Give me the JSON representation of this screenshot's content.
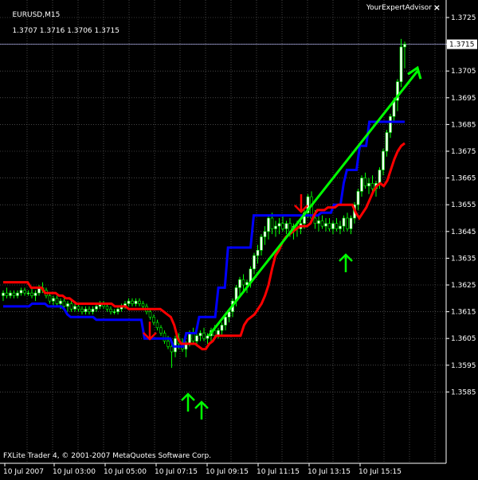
{
  "header": {
    "symbol": "EURUSD,M15",
    "ohlc": "1.3707 1.3716 1.3706 1.3715"
  },
  "expert": {
    "name": "YourExpertAdvisor",
    "close_glyph": "×",
    "icon": "close-icon"
  },
  "footer": {
    "copyright": "FXLite Trader 4, © 2001-2007 MetaQuotes Software Corp."
  },
  "price_label": "1.3715",
  "colors": {
    "background": "#000000",
    "grid": "#707070",
    "up_candle": "#ffffff",
    "down_candle": "#000000",
    "upper_line": "#0000ff",
    "lower_line": "#ff0000",
    "trend_arrow": "#00ff00",
    "signal_down": "#ff0000",
    "signal_up": "#00ff00",
    "current_price_line": "#c0c0ff"
  },
  "chart_data": {
    "type": "line",
    "x_labels": [
      "10 Jul 2007",
      "10 Jul 03:00",
      "10 Jul 05:00",
      "10 Jul 07:15",
      "10 Jul 09:15",
      "10 Jul 11:15",
      "10 Jul 13:15",
      "10 Jul 15:15"
    ],
    "y_ticks": [
      "1.3725",
      "1.3715",
      "1.3705",
      "1.3695",
      "1.3685",
      "1.3675",
      "1.3665",
      "1.3655",
      "1.3645",
      "1.3635",
      "1.3625",
      "1.3615",
      "1.3605",
      "1.3595",
      "1.3585"
    ],
    "ylim": [
      1.3585,
      1.3725
    ],
    "grid": true,
    "current_price": 1.3715,
    "series": [
      {
        "color": "#0000ff",
        "values": [
          1.3617,
          1.3617,
          1.3617,
          1.3617,
          1.3617,
          1.3617,
          1.3617,
          1.3617,
          1.3617,
          1.3618,
          1.3618,
          1.3618,
          1.3618,
          1.3618,
          1.3617,
          1.3617,
          1.3617,
          1.3617,
          1.3617,
          1.3616,
          1.3614,
          1.3613,
          1.3613,
          1.3613,
          1.3613,
          1.3613,
          1.3613,
          1.3613,
          1.3613,
          1.3612,
          1.3612,
          1.3612,
          1.3612,
          1.3612,
          1.3612,
          1.3612,
          1.3612,
          1.3612,
          1.3612,
          1.3612,
          1.3612,
          1.3612,
          1.3612,
          1.3612,
          1.3605,
          1.3605,
          1.3605,
          1.3605,
          1.3605,
          1.3605,
          1.3605,
          1.3605,
          1.3605,
          1.3602,
          1.3602,
          1.3602,
          1.3602,
          1.3607,
          1.3607,
          1.3607,
          1.3607,
          1.3613,
          1.3613,
          1.3613,
          1.3613,
          1.3613,
          1.3613,
          1.3624,
          1.3624,
          1.3624,
          1.3639,
          1.3639,
          1.3639,
          1.3639,
          1.3639,
          1.3639,
          1.3639,
          1.3639,
          1.3651,
          1.3651,
          1.3651,
          1.3651,
          1.3651,
          1.3651,
          1.3651,
          1.3651,
          1.3651,
          1.3651,
          1.3651,
          1.3651,
          1.3651,
          1.3651,
          1.3651,
          1.3651,
          1.3651,
          1.3651,
          1.3651,
          1.3651,
          1.3651,
          1.3652,
          1.3652,
          1.3652,
          1.3652,
          1.3655,
          1.3655,
          1.3655,
          1.3663,
          1.3668,
          1.3668,
          1.3668,
          1.3668,
          1.3677,
          1.3677,
          1.3677,
          1.3686,
          1.3686,
          1.3686,
          1.3686,
          1.3686,
          1.3686,
          1.3686,
          1.3686,
          1.3686,
          1.3686,
          1.3686,
          1.3686
        ]
      },
      {
        "color": "#ff0000",
        "values": [
          1.3626,
          1.3626,
          1.3626,
          1.3626,
          1.3626,
          1.3626,
          1.3626,
          1.3626,
          1.3624,
          1.3624,
          1.3624,
          1.3624,
          1.3622,
          1.3622,
          1.3622,
          1.3622,
          1.3621,
          1.3621,
          1.362,
          1.362,
          1.3619,
          1.3618,
          1.3618,
          1.3618,
          1.3618,
          1.3618,
          1.3618,
          1.3618,
          1.3618,
          1.3618,
          1.3618,
          1.3618,
          1.3617,
          1.3617,
          1.3617,
          1.3617,
          1.3616,
          1.3616,
          1.3616,
          1.3616,
          1.3616,
          1.3616,
          1.3616,
          1.3616,
          1.3616,
          1.3616,
          1.3615,
          1.3614,
          1.3613,
          1.361,
          1.3605,
          1.3603,
          1.3603,
          1.3603,
          1.3603,
          1.3603,
          1.3602,
          1.3601,
          1.3601,
          1.3603,
          1.3604,
          1.3606,
          1.3606,
          1.3606,
          1.3606,
          1.3606,
          1.3606,
          1.3606,
          1.3606,
          1.361,
          1.3612,
          1.3613,
          1.3614,
          1.3616,
          1.3618,
          1.3621,
          1.3625,
          1.3631,
          1.3636,
          1.3638,
          1.3641,
          1.3643,
          1.3644,
          1.3645,
          1.3646,
          1.3647,
          1.3647,
          1.3647,
          1.3648,
          1.3651,
          1.3653,
          1.3653,
          1.3653,
          1.3654,
          1.3654,
          1.3654,
          1.3655,
          1.3655,
          1.3655,
          1.3655,
          1.3655,
          1.3652,
          1.365,
          1.3652,
          1.3654,
          1.3657,
          1.366,
          1.3662,
          1.3663,
          1.3662,
          1.3664,
          1.3668,
          1.3672,
          1.3675,
          1.3677,
          1.3678
        ]
      }
    ],
    "candles": [
      {
        "o": 1.3621,
        "h": 1.3623,
        "l": 1.3619,
        "c": 1.3622
      },
      {
        "o": 1.3622,
        "h": 1.3624,
        "l": 1.362,
        "c": 1.3621
      },
      {
        "o": 1.3621,
        "h": 1.3623,
        "l": 1.362,
        "c": 1.3622
      },
      {
        "o": 1.3622,
        "h": 1.3623,
        "l": 1.362,
        "c": 1.3621
      },
      {
        "o": 1.3621,
        "h": 1.3623,
        "l": 1.362,
        "c": 1.3622
      },
      {
        "o": 1.3622,
        "h": 1.3624,
        "l": 1.3621,
        "c": 1.3623
      },
      {
        "o": 1.3623,
        "h": 1.3624,
        "l": 1.3621,
        "c": 1.3622
      },
      {
        "o": 1.3622,
        "h": 1.3623,
        "l": 1.3621,
        "c": 1.3622
      },
      {
        "o": 1.3622,
        "h": 1.3624,
        "l": 1.362,
        "c": 1.3621
      },
      {
        "o": 1.3621,
        "h": 1.3623,
        "l": 1.3619,
        "c": 1.3622
      },
      {
        "o": 1.3622,
        "h": 1.3625,
        "l": 1.3621,
        "c": 1.3624
      },
      {
        "o": 1.3624,
        "h": 1.3626,
        "l": 1.3622,
        "c": 1.3623
      },
      {
        "o": 1.3623,
        "h": 1.3624,
        "l": 1.362,
        "c": 1.3621
      },
      {
        "o": 1.3621,
        "h": 1.3622,
        "l": 1.3618,
        "c": 1.3619
      },
      {
        "o": 1.3619,
        "h": 1.3621,
        "l": 1.3617,
        "c": 1.362
      },
      {
        "o": 1.362,
        "h": 1.3621,
        "l": 1.3617,
        "c": 1.3618
      },
      {
        "o": 1.3618,
        "h": 1.362,
        "l": 1.3616,
        "c": 1.3619
      },
      {
        "o": 1.3619,
        "h": 1.362,
        "l": 1.3616,
        "c": 1.3617
      },
      {
        "o": 1.3617,
        "h": 1.3619,
        "l": 1.3615,
        "c": 1.3618
      },
      {
        "o": 1.3618,
        "h": 1.3619,
        "l": 1.3615,
        "c": 1.3616
      },
      {
        "o": 1.3616,
        "h": 1.3618,
        "l": 1.3615,
        "c": 1.3617
      },
      {
        "o": 1.3617,
        "h": 1.3618,
        "l": 1.3615,
        "c": 1.3616
      },
      {
        "o": 1.3616,
        "h": 1.3617,
        "l": 1.3614,
        "c": 1.3615
      },
      {
        "o": 1.3615,
        "h": 1.3617,
        "l": 1.3614,
        "c": 1.3616
      },
      {
        "o": 1.3616,
        "h": 1.3617,
        "l": 1.3614,
        "c": 1.3615
      },
      {
        "o": 1.3615,
        "h": 1.3617,
        "l": 1.3614,
        "c": 1.3616
      },
      {
        "o": 1.3616,
        "h": 1.3618,
        "l": 1.3615,
        "c": 1.3617
      },
      {
        "o": 1.3617,
        "h": 1.3619,
        "l": 1.3616,
        "c": 1.3618
      },
      {
        "o": 1.3618,
        "h": 1.3619,
        "l": 1.3616,
        "c": 1.3617
      },
      {
        "o": 1.3617,
        "h": 1.3618,
        "l": 1.3615,
        "c": 1.3616
      },
      {
        "o": 1.3616,
        "h": 1.3617,
        "l": 1.3614,
        "c": 1.3615
      },
      {
        "o": 1.3615,
        "h": 1.3616,
        "l": 1.3614,
        "c": 1.3615
      },
      {
        "o": 1.3615,
        "h": 1.3617,
        "l": 1.3614,
        "c": 1.3616
      },
      {
        "o": 1.3616,
        "h": 1.3618,
        "l": 1.3615,
        "c": 1.3617
      },
      {
        "o": 1.3617,
        "h": 1.3619,
        "l": 1.3616,
        "c": 1.3618
      },
      {
        "o": 1.3618,
        "h": 1.362,
        "l": 1.3617,
        "c": 1.3619
      },
      {
        "o": 1.3619,
        "h": 1.362,
        "l": 1.3617,
        "c": 1.3618
      },
      {
        "o": 1.3618,
        "h": 1.362,
        "l": 1.3617,
        "c": 1.3619
      },
      {
        "o": 1.3619,
        "h": 1.362,
        "l": 1.3617,
        "c": 1.3618
      },
      {
        "o": 1.3618,
        "h": 1.3619,
        "l": 1.3616,
        "c": 1.3617
      },
      {
        "o": 1.3617,
        "h": 1.3618,
        "l": 1.3614,
        "c": 1.3615
      },
      {
        "o": 1.3615,
        "h": 1.3616,
        "l": 1.3612,
        "c": 1.3613
      },
      {
        "o": 1.3613,
        "h": 1.3614,
        "l": 1.361,
        "c": 1.3611
      },
      {
        "o": 1.3611,
        "h": 1.3612,
        "l": 1.3608,
        "c": 1.3609
      },
      {
        "o": 1.3609,
        "h": 1.361,
        "l": 1.3606,
        "c": 1.3607
      },
      {
        "o": 1.3607,
        "h": 1.3608,
        "l": 1.3603,
        "c": 1.3604
      },
      {
        "o": 1.3604,
        "h": 1.3606,
        "l": 1.3601,
        "c": 1.3602
      },
      {
        "o": 1.3602,
        "h": 1.3604,
        "l": 1.3594,
        "c": 1.36
      },
      {
        "o": 1.36,
        "h": 1.3606,
        "l": 1.3598,
        "c": 1.3605
      },
      {
        "o": 1.3605,
        "h": 1.3607,
        "l": 1.3601,
        "c": 1.3603
      },
      {
        "o": 1.3603,
        "h": 1.3605,
        "l": 1.36,
        "c": 1.3601
      },
      {
        "o": 1.3601,
        "h": 1.3604,
        "l": 1.3598,
        "c": 1.3603
      },
      {
        "o": 1.3603,
        "h": 1.3608,
        "l": 1.3602,
        "c": 1.3607
      },
      {
        "o": 1.3607,
        "h": 1.3609,
        "l": 1.3603,
        "c": 1.3604
      },
      {
        "o": 1.3604,
        "h": 1.3607,
        "l": 1.3602,
        "c": 1.3606
      },
      {
        "o": 1.3606,
        "h": 1.3608,
        "l": 1.3604,
        "c": 1.3607
      },
      {
        "o": 1.3607,
        "h": 1.3609,
        "l": 1.3604,
        "c": 1.3605
      },
      {
        "o": 1.3605,
        "h": 1.3607,
        "l": 1.3603,
        "c": 1.3606
      },
      {
        "o": 1.3606,
        "h": 1.3609,
        "l": 1.3604,
        "c": 1.3608
      },
      {
        "o": 1.3608,
        "h": 1.361,
        "l": 1.3605,
        "c": 1.3606
      },
      {
        "o": 1.3606,
        "h": 1.3609,
        "l": 1.3605,
        "c": 1.3608
      },
      {
        "o": 1.3608,
        "h": 1.3611,
        "l": 1.3606,
        "c": 1.361
      },
      {
        "o": 1.361,
        "h": 1.3614,
        "l": 1.3608,
        "c": 1.3613
      },
      {
        "o": 1.3613,
        "h": 1.3616,
        "l": 1.3611,
        "c": 1.3615
      },
      {
        "o": 1.3615,
        "h": 1.362,
        "l": 1.3613,
        "c": 1.3619
      },
      {
        "o": 1.3619,
        "h": 1.3625,
        "l": 1.3617,
        "c": 1.3624
      },
      {
        "o": 1.3624,
        "h": 1.3628,
        "l": 1.3621,
        "c": 1.3627
      },
      {
        "o": 1.3627,
        "h": 1.3629,
        "l": 1.3623,
        "c": 1.3625
      },
      {
        "o": 1.3625,
        "h": 1.3627,
        "l": 1.3622,
        "c": 1.3626
      },
      {
        "o": 1.3626,
        "h": 1.3632,
        "l": 1.3624,
        "c": 1.3631
      },
      {
        "o": 1.3631,
        "h": 1.3637,
        "l": 1.3629,
        "c": 1.3636
      },
      {
        "o": 1.3636,
        "h": 1.364,
        "l": 1.3633,
        "c": 1.3638
      },
      {
        "o": 1.3638,
        "h": 1.3644,
        "l": 1.3636,
        "c": 1.3643
      },
      {
        "o": 1.3643,
        "h": 1.3647,
        "l": 1.364,
        "c": 1.3645
      },
      {
        "o": 1.3645,
        "h": 1.3651,
        "l": 1.3642,
        "c": 1.365
      },
      {
        "o": 1.365,
        "h": 1.3652,
        "l": 1.3644,
        "c": 1.3646
      },
      {
        "o": 1.3646,
        "h": 1.3649,
        "l": 1.3643,
        "c": 1.3647
      },
      {
        "o": 1.3647,
        "h": 1.365,
        "l": 1.3644,
        "c": 1.3648
      },
      {
        "o": 1.3648,
        "h": 1.3651,
        "l": 1.3645,
        "c": 1.3646
      },
      {
        "o": 1.3646,
        "h": 1.3649,
        "l": 1.3644,
        "c": 1.3648
      },
      {
        "o": 1.3648,
        "h": 1.365,
        "l": 1.3643,
        "c": 1.3645
      },
      {
        "o": 1.3645,
        "h": 1.3648,
        "l": 1.3642,
        "c": 1.3647
      },
      {
        "o": 1.3647,
        "h": 1.3649,
        "l": 1.3643,
        "c": 1.3646
      },
      {
        "o": 1.3646,
        "h": 1.365,
        "l": 1.3644,
        "c": 1.3648
      },
      {
        "o": 1.3648,
        "h": 1.3653,
        "l": 1.3646,
        "c": 1.3652
      },
      {
        "o": 1.3652,
        "h": 1.3659,
        "l": 1.365,
        "c": 1.3658
      },
      {
        "o": 1.3658,
        "h": 1.366,
        "l": 1.3648,
        "c": 1.365
      },
      {
        "o": 1.365,
        "h": 1.3653,
        "l": 1.3646,
        "c": 1.3648
      },
      {
        "o": 1.3648,
        "h": 1.3651,
        "l": 1.3645,
        "c": 1.3649
      },
      {
        "o": 1.3649,
        "h": 1.3651,
        "l": 1.3646,
        "c": 1.3647
      },
      {
        "o": 1.3647,
        "h": 1.365,
        "l": 1.3645,
        "c": 1.3648
      },
      {
        "o": 1.3648,
        "h": 1.365,
        "l": 1.3645,
        "c": 1.3646
      },
      {
        "o": 1.3646,
        "h": 1.3649,
        "l": 1.3644,
        "c": 1.3648
      },
      {
        "o": 1.3648,
        "h": 1.365,
        "l": 1.3645,
        "c": 1.3646
      },
      {
        "o": 1.3646,
        "h": 1.3649,
        "l": 1.3644,
        "c": 1.3647
      },
      {
        "o": 1.3647,
        "h": 1.3651,
        "l": 1.3645,
        "c": 1.365
      },
      {
        "o": 1.365,
        "h": 1.3652,
        "l": 1.3645,
        "c": 1.3646
      },
      {
        "o": 1.3646,
        "h": 1.3651,
        "l": 1.3644,
        "c": 1.365
      },
      {
        "o": 1.365,
        "h": 1.3656,
        "l": 1.3648,
        "c": 1.3655
      },
      {
        "o": 1.3655,
        "h": 1.3661,
        "l": 1.3653,
        "c": 1.366
      },
      {
        "o": 1.366,
        "h": 1.3666,
        "l": 1.3658,
        "c": 1.3665
      },
      {
        "o": 1.3665,
        "h": 1.3667,
        "l": 1.3661,
        "c": 1.3662
      },
      {
        "o": 1.3662,
        "h": 1.3665,
        "l": 1.3659,
        "c": 1.3663
      },
      {
        "o": 1.3663,
        "h": 1.3666,
        "l": 1.366,
        "c": 1.3661
      },
      {
        "o": 1.3661,
        "h": 1.3664,
        "l": 1.3658,
        "c": 1.3663
      },
      {
        "o": 1.3663,
        "h": 1.3669,
        "l": 1.3661,
        "c": 1.3668
      },
      {
        "o": 1.3668,
        "h": 1.3676,
        "l": 1.3666,
        "c": 1.3675
      },
      {
        "o": 1.3675,
        "h": 1.3683,
        "l": 1.3673,
        "c": 1.3682
      },
      {
        "o": 1.3682,
        "h": 1.3689,
        "l": 1.368,
        "c": 1.3688
      },
      {
        "o": 1.3688,
        "h": 1.3695,
        "l": 1.3686,
        "c": 1.3694
      },
      {
        "o": 1.3694,
        "h": 1.3702,
        "l": 1.369,
        "c": 1.3701
      },
      {
        "o": 1.3701,
        "h": 1.3717,
        "l": 1.3699,
        "c": 1.3714
      },
      {
        "o": 1.3714,
        "h": 1.3716,
        "l": 1.3706,
        "c": 1.3715
      }
    ],
    "trend_arrow_values": {
      "start": 1.3606,
      "end": 1.3705
    },
    "signals": [
      {
        "type": "down",
        "color": "#ff0000"
      },
      {
        "type": "up",
        "color": "#00ff00"
      },
      {
        "type": "up",
        "color": "#00ff00"
      },
      {
        "type": "down",
        "color": "#ff0000"
      },
      {
        "type": "up",
        "color": "#00ff00"
      }
    ]
  }
}
